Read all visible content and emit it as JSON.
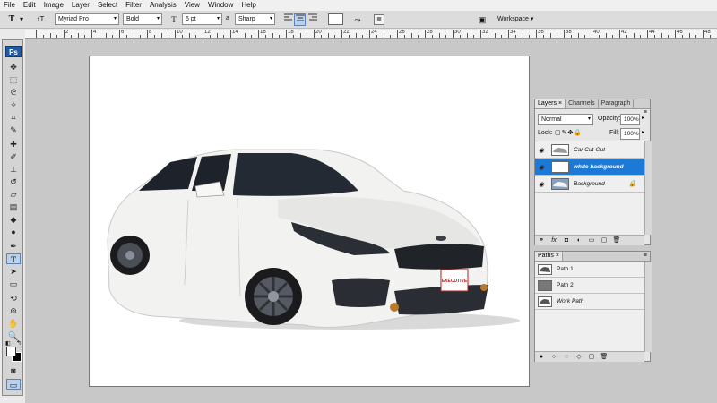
{
  "menu": [
    "File",
    "Edit",
    "Image",
    "Layer",
    "Select",
    "Filter",
    "Analysis",
    "View",
    "Window",
    "Help"
  ],
  "options_bar": {
    "font_family": "Myriad Pro",
    "font_style": "Bold",
    "font_size": "6 pt",
    "aa_label": "a",
    "antialias": "Sharp",
    "workspace": "Workspace"
  },
  "ruler_numbers": [
    "2",
    "4",
    "6",
    "8",
    "10",
    "12",
    "14",
    "16",
    "18",
    "20",
    "22",
    "24",
    "26",
    "28",
    "30",
    "32",
    "34",
    "36",
    "38",
    "40",
    "42",
    "44",
    "46",
    "48"
  ],
  "toolbox": {
    "logo": "Ps"
  },
  "canvas": {
    "plate_text": "EXECUTIVE"
  },
  "layers_panel": {
    "tabs": [
      "Layers",
      "Channels",
      "Paragraph"
    ],
    "blend_mode": "Normal",
    "opacity_label": "Opacity:",
    "opacity": "100%",
    "lock_label": "Lock:",
    "fill_label": "Fill:",
    "fill": "100%",
    "layers": [
      {
        "name": "Car Cut-Out",
        "selected": false
      },
      {
        "name": "white background",
        "selected": true
      },
      {
        "name": "Background",
        "selected": false
      }
    ]
  },
  "paths_panel": {
    "tabs": [
      "Paths"
    ],
    "paths": [
      "Path 1",
      "Path 2",
      "Work Path"
    ]
  },
  "colors": {
    "selection_blue": "#1c7ad6",
    "canvas_bg": "#ffffff",
    "car_body": "#f2f2f0"
  }
}
